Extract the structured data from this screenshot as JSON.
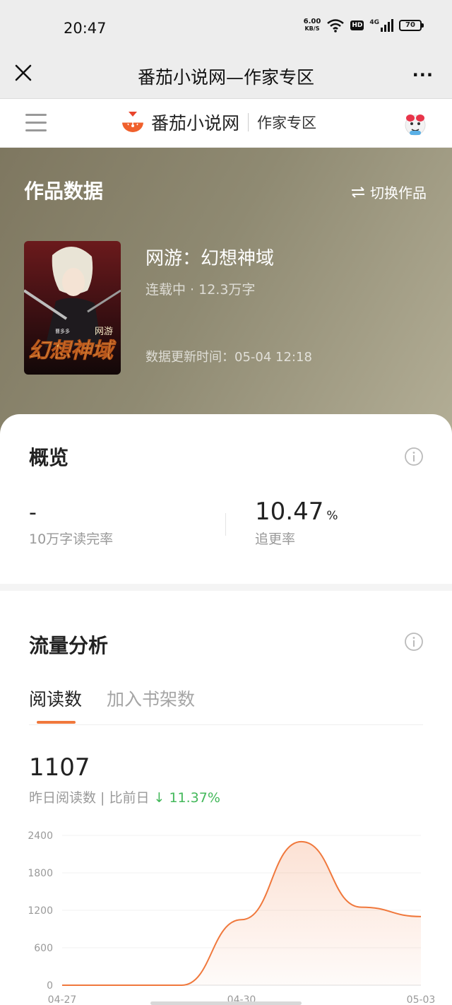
{
  "status_bar": {
    "time": "20:47",
    "net_speed_value": "6.00",
    "net_speed_unit": "KB/S",
    "hd_badge": "HD",
    "signal_label": "4G",
    "battery": "70"
  },
  "wechat": {
    "title": "番茄小说网—作家专区",
    "more_label": "···"
  },
  "site": {
    "brand_name": "番茄小说网",
    "section": "作家专区"
  },
  "hero": {
    "title": "作品数据",
    "switch_label": "切换作品",
    "book": {
      "title": "网游：幻想神域",
      "status": "连载中 · 12.3万字",
      "update": "数据更新时间：05-04 12:18",
      "cover_small_text": "网游",
      "cover_big_text": "幻想神域",
      "cover_author": "曹多多"
    }
  },
  "overview": {
    "title": "概览",
    "left_value": "-",
    "left_label": "10万字读完率",
    "right_value": "10.47",
    "right_unit": "%",
    "right_label": "追更率"
  },
  "traffic": {
    "title": "流量分析",
    "tabs": [
      "阅读数",
      "加入书架数"
    ],
    "big_number": "1107",
    "compare_label": "昨日阅读数 | 比前日",
    "compare_value": "↓ 11.37%"
  },
  "chart_data": {
    "type": "area",
    "title": "",
    "xlabel": "",
    "ylabel": "",
    "ylim": [
      0,
      2400
    ],
    "yticks": [
      0,
      600,
      1200,
      1800,
      2400
    ],
    "ytick_labels": [
      "0",
      "600",
      "1200",
      "1800",
      "2400"
    ],
    "x": [
      "04-27",
      "04-28",
      "04-29",
      "04-30",
      "05-01",
      "05-02",
      "05-03"
    ],
    "xtick_labels": [
      "04-27",
      "04-30",
      "05-03"
    ],
    "values": [
      0,
      0,
      0,
      1050,
      2300,
      1250,
      1100
    ],
    "color": "#f0783c",
    "grid": true
  },
  "colors": {
    "accent": "#f0783c",
    "down": "#43b85a"
  }
}
